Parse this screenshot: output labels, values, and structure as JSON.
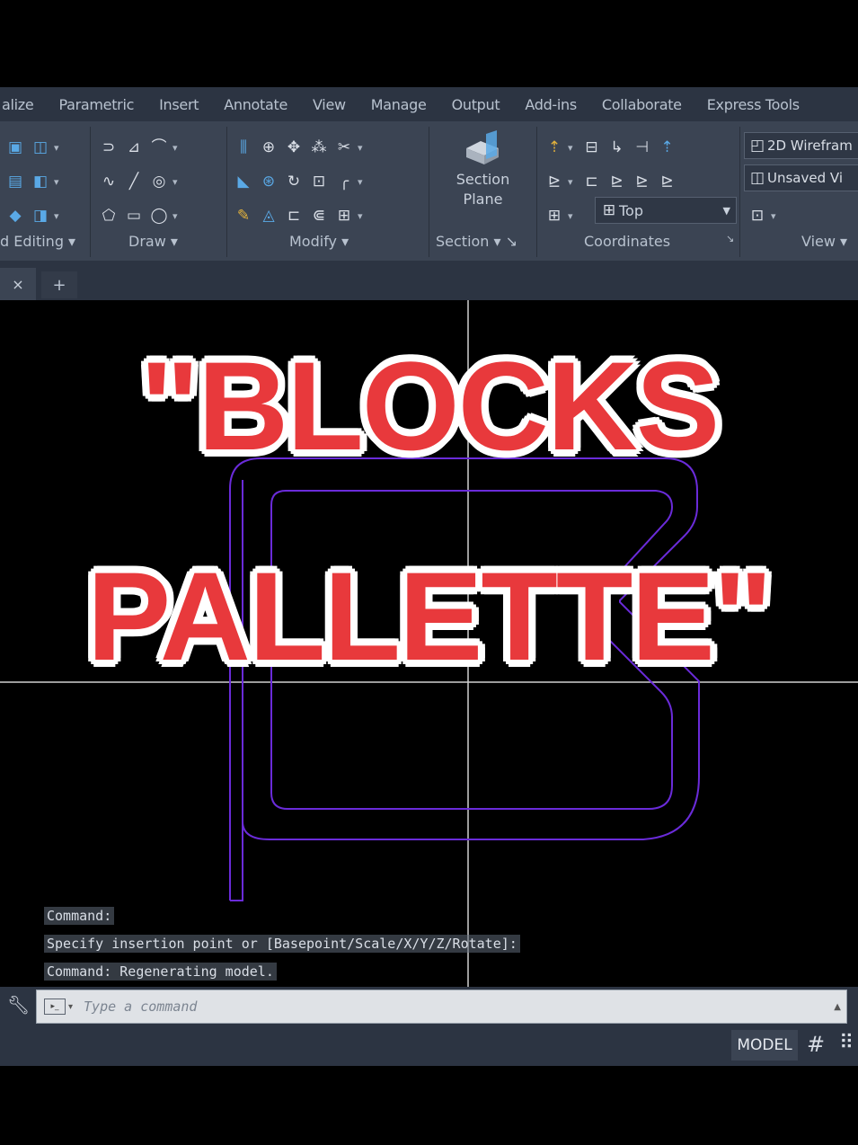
{
  "ribbon_tabs": [
    "alize",
    "Parametric",
    "Insert",
    "Annotate",
    "View",
    "Manage",
    "Output",
    "Add-ins",
    "Collaborate",
    "Express Tools"
  ],
  "panels": {
    "solid_editing": "d Editing",
    "draw": "Draw",
    "modify": "Modify",
    "section": "Section",
    "coordinates": "Coordinates",
    "view": "View"
  },
  "section_button": {
    "line1": "Section",
    "line2": "Plane"
  },
  "view_dropdown": {
    "value": "Top"
  },
  "visual_style": "2D Wirefram",
  "saved_view": "Unsaved Vi",
  "file_tab": {
    "close": "×",
    "add": "+"
  },
  "command_history": [
    "Command:",
    "Specify insertion point or [Basepoint/Scale/X/Y/Z/Rotate]:",
    "Command: Regenerating model."
  ],
  "command_line": {
    "placeholder": "Type a command"
  },
  "status_bar": {
    "model": "MODEL"
  },
  "overlay_title": {
    "line1": "\"BLOCKS",
    "line2": "PALLETTE\""
  },
  "colors": {
    "overlay_red": "#e8393c",
    "drawing_purple": "#6a2bd9",
    "ribbon_bg": "#3b4453"
  }
}
